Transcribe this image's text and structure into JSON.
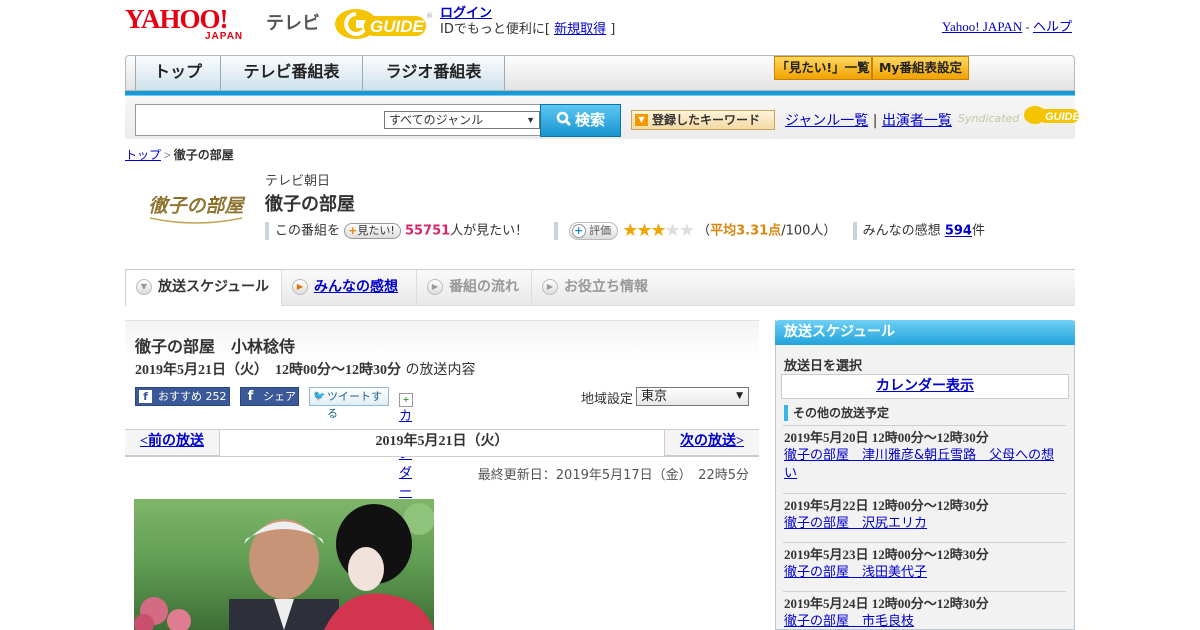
{
  "header": {
    "logo_yahoo": "YAHOO!",
    "logo_japan": "JAPAN",
    "logo_tv": "テレビ",
    "logo_gguide": "GUIDE",
    "login": "ログイン",
    "login_sub_prefix": "IDでもっと便利に[",
    "signup": "新規取得",
    "login_sub_suffix": "]",
    "yahoo_japan_link": "Yahoo! JAPAN",
    "link_sep": " - ",
    "help_link": "ヘルプ"
  },
  "nav": {
    "tabs": [
      "トップ",
      "テレビ番組表",
      "ラジオ番組表"
    ],
    "mitai_list": "「見たい!」一覧",
    "my_schedule": "My番組表設定"
  },
  "search": {
    "input_value": "",
    "genre_selected": "すべてのジャンル",
    "button": "検索",
    "keyword_button": "登録したキーワード",
    "genre_list": "ジャンル一覧",
    "separator": "|",
    "performer_list": "出演者一覧",
    "syndicated": "Syndicated"
  },
  "breadcrumb": {
    "top": "トップ",
    "sep": " > ",
    "current": "徹子の部屋"
  },
  "program": {
    "logo_text": "徹子の部屋",
    "station": "テレビ朝日",
    "title": "徹子の部屋",
    "mitai_prefix": "この番組を",
    "mitai_button": "見たい!",
    "mitai_count": "55751",
    "mitai_suffix": "人が見たい！",
    "hyoka_button": "評価",
    "rating_stars": 3,
    "rating_max": 5,
    "rating_open": "（",
    "rating_avg": "平均3.31点",
    "rating_count": "/100人）",
    "kansou_prefix": "みんなの感想",
    "kansou_count": "594",
    "kansou_suffix": "件"
  },
  "tabs": [
    {
      "label": "放送スケジュール",
      "state": "active"
    },
    {
      "label": "みんなの感想",
      "state": "link"
    },
    {
      "label": "番組の流れ",
      "state": "disabled"
    },
    {
      "label": "お役立ち情報",
      "state": "disabled"
    }
  ],
  "episode": {
    "title": "徹子の部屋　小林稔侍",
    "date_time": "2019年5月21日（火）　12時00分～12時30分",
    "date_suffix": " の放送内容",
    "fb_recommend": "おすすめ",
    "fb_count": "252",
    "fb_share": "シェア",
    "tweet": "ツイートする",
    "calendar": "カレンダーに登録",
    "region_label": "地域設定",
    "region_value": "東京",
    "prev": "<前の放送",
    "current_date": "2019年5月21日（火）",
    "next": "次の放送>",
    "updated": "最終更新日：2019年5月17日（金）　22時5分"
  },
  "sidebar": {
    "title": "放送スケジュール",
    "pick_label": "放送日を選択",
    "calendar_link": "カレンダー表示",
    "other_label": "その他の放送予定",
    "items": [
      {
        "date": "2019年5月20日  12時00分～12時30分",
        "title": "徹子の部屋　津川雅彦&朝丘雪路　父母への想い"
      },
      {
        "date": "2019年5月22日  12時00分～12時30分",
        "title": "徹子の部屋　沢尻エリカ"
      },
      {
        "date": "2019年5月23日  12時00分～12時30分",
        "title": "徹子の部屋　浅田美代子"
      },
      {
        "date": "2019年5月24日  12時00分～12時30分",
        "title": "徹子の部屋　市毛良枝"
      }
    ]
  },
  "colors": {
    "nav_accent": "#129bd8",
    "link": "#0000cc",
    "yahoo_red": "#e60012",
    "mitai_pink": "#d6276b",
    "rating_orange": "#d9860f"
  }
}
